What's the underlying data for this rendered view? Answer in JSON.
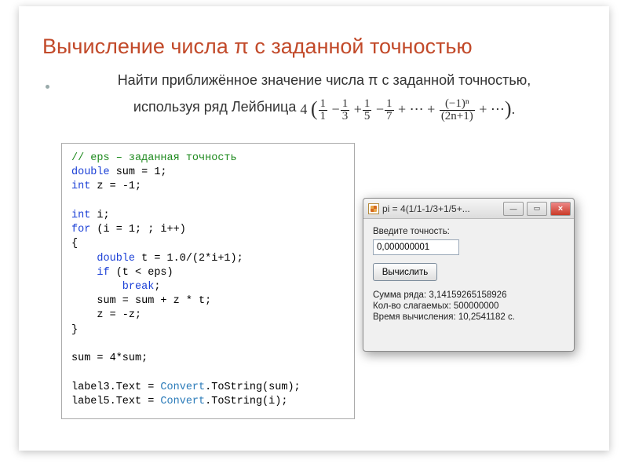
{
  "title": "Вычисление числа π с заданной точностью",
  "desc_part1": "Найти приближённое значение числа π с заданной точностью,",
  "desc_part2": "используя ряд Лейбница ",
  "formula": {
    "prefix": "4",
    "f1n": "1",
    "f1d": "1",
    "f2n": "1",
    "f2d": "3",
    "f3n": "1",
    "f3d": "5",
    "f4n": "1",
    "f4d": "7",
    "fln_top": "(−1)ⁿ",
    "fln_bot": "(2n+1)",
    "dots": "⋯",
    "closer": "."
  },
  "code": {
    "l1": "// eps – заданная точность",
    "l2a": "double",
    "l2b": " sum = 1;",
    "l3a": "int",
    "l3b": " z = -1;",
    "l4": "",
    "l5a": "int",
    "l5b": " i;",
    "l6a": "for",
    "l6b": " (i = 1; ; i++)",
    "l7": "{",
    "l8a": "    double",
    "l8b": " t = 1.0/(2*i+1);",
    "l9a": "    if",
    "l9b": " (t < eps)",
    "l10a": "        break",
    "l10b": ";",
    "l11": "    sum = sum + z * t;",
    "l12": "    z = -z;",
    "l13": "}",
    "l14": "",
    "l15": "sum = 4*sum;",
    "l16": "",
    "l17a": "label3.Text = ",
    "l17b": "Convert",
    "l17c": ".ToString(sum);",
    "l18a": "label5.Text = ",
    "l18b": "Convert",
    "l18c": ".ToString(i);"
  },
  "window": {
    "title": "pi = 4(1/1-1/3+1/5+...",
    "btn_min": "—",
    "btn_max": "▭",
    "btn_close": "×",
    "label_precision": "Введите точность:",
    "input_value": "0,000000001",
    "button_calc": "Вычислить",
    "result_sum_label": "Сумма ряда: ",
    "result_sum_value": "3,14159265158926",
    "result_count_label": "Кол-во слагаемых: ",
    "result_count_value": "500000000",
    "result_time_label": "Время вычисления: ",
    "result_time_value": "10,2541182 с."
  }
}
